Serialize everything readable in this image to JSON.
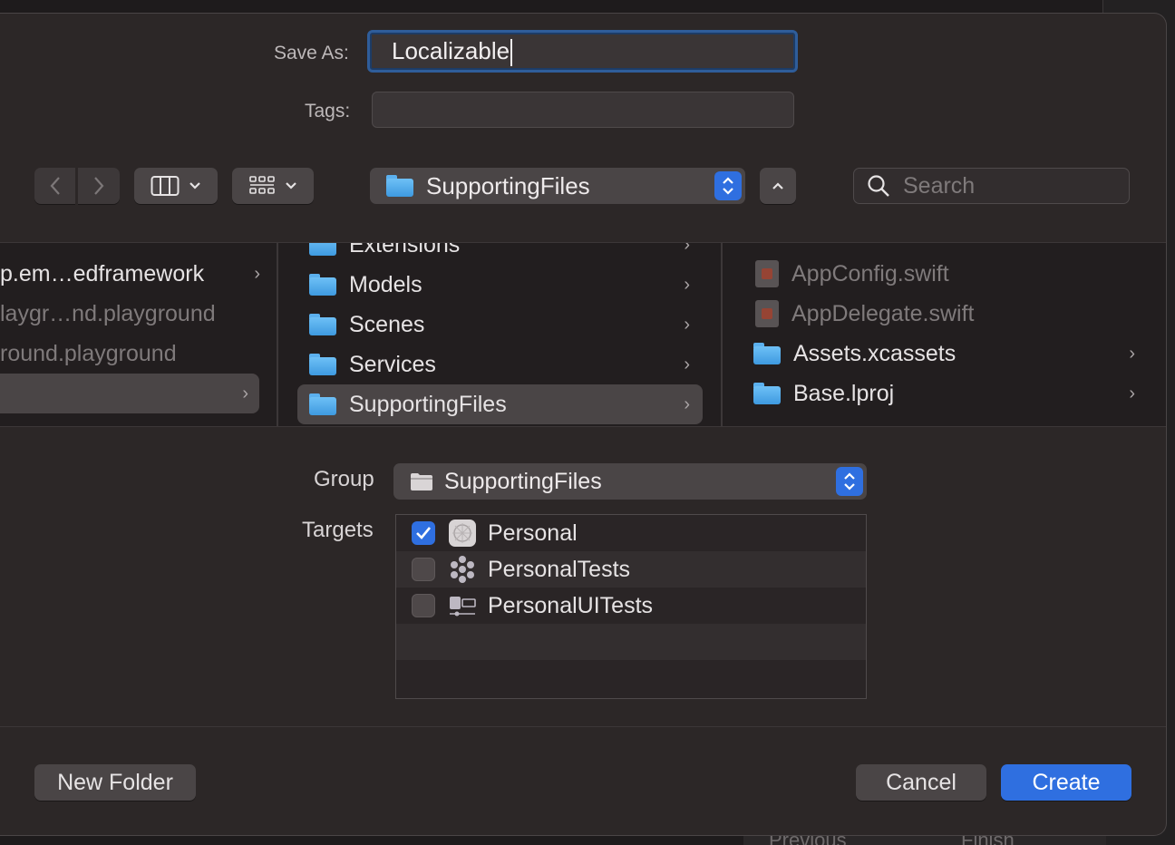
{
  "save_as": {
    "label": "Save As:",
    "value": "Localizable"
  },
  "tags": {
    "label": "Tags:",
    "value": ""
  },
  "toolbar": {
    "location": "SupportingFiles",
    "search_placeholder": "Search"
  },
  "browser": {
    "col1": [
      {
        "label": "p.em…edframework",
        "dim": false,
        "chevron": true
      },
      {
        "label": "laygr…nd.playground",
        "dim": true,
        "chevron": false
      },
      {
        "label": "round.playground",
        "dim": true,
        "chevron": false
      },
      {
        "label": "",
        "dim": false,
        "chevron": true,
        "selected": true
      }
    ],
    "col2": [
      {
        "label": "Extensions"
      },
      {
        "label": "Models"
      },
      {
        "label": "Scenes"
      },
      {
        "label": "Services"
      },
      {
        "label": "SupportingFiles",
        "selected": true
      }
    ],
    "col3": [
      {
        "label": "AppConfig.swift",
        "kind": "swift"
      },
      {
        "label": "AppDelegate.swift",
        "kind": "swift"
      },
      {
        "label": "Assets.xcassets",
        "kind": "folder"
      },
      {
        "label": "Base.lproj",
        "kind": "folder"
      }
    ]
  },
  "group": {
    "label": "Group",
    "value": "SupportingFiles"
  },
  "targets": {
    "label": "Targets",
    "items": [
      {
        "name": "Personal",
        "checked": true
      },
      {
        "name": "PersonalTests",
        "checked": false
      },
      {
        "name": "PersonalUITests",
        "checked": false
      }
    ]
  },
  "buttons": {
    "new_folder": "New Folder",
    "cancel": "Cancel",
    "create": "Create"
  },
  "background": {
    "previous": "Previous",
    "finish": "Finish"
  },
  "colors": {
    "accent": "#2f6fe0",
    "sheet": "#2c2727",
    "selection": "#4a4546"
  }
}
